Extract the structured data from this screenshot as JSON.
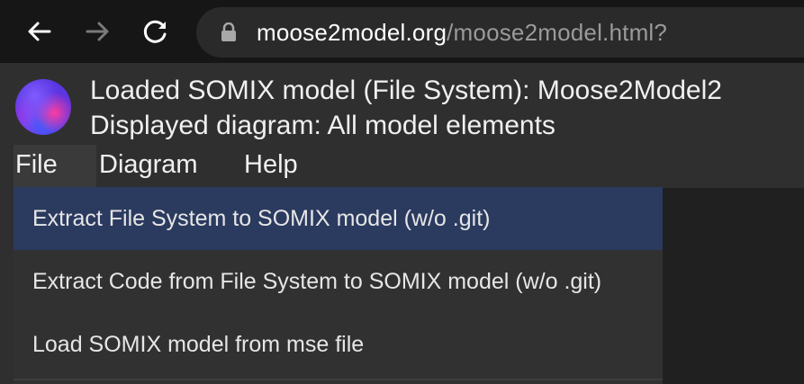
{
  "browser": {
    "url_host": "moose2model.org",
    "url_path": "/moose2model.html?",
    "icons": {
      "back": "arrow-left-icon",
      "forward": "arrow-right-icon",
      "reload": "reload-icon",
      "lock": "lock-icon"
    }
  },
  "app": {
    "logo": "app-logo",
    "loaded_text": "Loaded SOMIX model (File System): Moose2Model2",
    "displayed_text": "Displayed diagram: All model elements"
  },
  "menu": {
    "file": "File",
    "diagram": "Diagram",
    "help": "Help"
  },
  "dropdown": {
    "items": [
      "Extract File System to SOMIX model (w/o .git)",
      "Extract Code from File System to SOMIX model (w/o .git)",
      "Load SOMIX model from mse file"
    ],
    "highlighted_index": 0
  },
  "colors": {
    "toolbar_bg": "#161616",
    "omnibox_bg": "#2a2a2a",
    "app_bg": "#2f2f2f",
    "dropdown_bg": "#313131",
    "highlight_bg": "#2b3a5f"
  }
}
